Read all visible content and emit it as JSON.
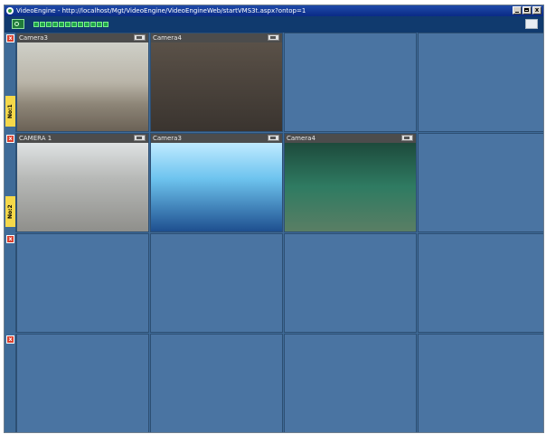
{
  "window": {
    "title": "VideoEngine - http://localhost/Mgt/VideoEngine/VideoEngineWeb/startVMS3t.aspx?ontop=1",
    "controls": {
      "minimize": "_",
      "maximize": "□",
      "close": "x"
    }
  },
  "toolbar": {
    "camera_icon": "camera-switch-icon",
    "segments": 12
  },
  "rows": [
    {
      "tag": "No:1",
      "close": "x",
      "cells": [
        {
          "label": "Camera3",
          "feed": "lobby"
        },
        {
          "label": "Camera4",
          "feed": "office"
        },
        {
          "label": "",
          "feed": ""
        },
        {
          "label": "",
          "feed": ""
        }
      ]
    },
    {
      "tag": "No:2",
      "close": "x",
      "cells": [
        {
          "label": "CAMERA 1",
          "feed": "airport1"
        },
        {
          "label": "Camera3",
          "feed": "airport2"
        },
        {
          "label": "Camera4",
          "feed": "station"
        },
        {
          "label": "",
          "feed": ""
        }
      ]
    },
    {
      "tag": "",
      "close": "x",
      "cells": [
        {
          "label": "",
          "feed": ""
        },
        {
          "label": "",
          "feed": ""
        },
        {
          "label": "",
          "feed": ""
        },
        {
          "label": "",
          "feed": ""
        }
      ]
    },
    {
      "tag": "",
      "close": "x",
      "cells": [
        {
          "label": "",
          "feed": ""
        },
        {
          "label": "",
          "feed": ""
        },
        {
          "label": "",
          "feed": ""
        },
        {
          "label": "",
          "feed": ""
        }
      ]
    }
  ],
  "colors": {
    "grid_background": "#3f6b98",
    "empty_cell": "#4a74a2",
    "row_tag": "#f5d84a",
    "close_button": "#d9412f"
  }
}
